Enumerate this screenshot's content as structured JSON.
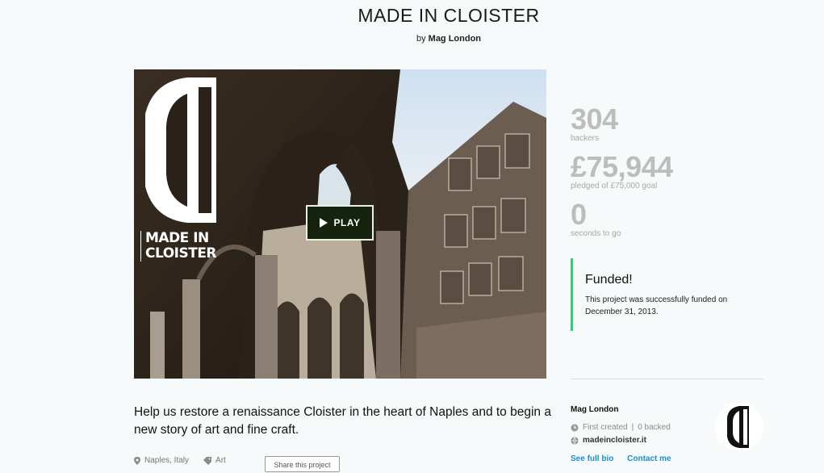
{
  "project": {
    "title": "MADE IN CLOISTER",
    "by_prefix": "by",
    "creator": "Mag London"
  },
  "video": {
    "play_label": "PLAY",
    "logo_text_line1": "MADE IN",
    "logo_text_line2": "CLOISTER"
  },
  "stats": {
    "backers_count": "304",
    "backers_label": "backers",
    "pledged_amount": "£75,944",
    "pledged_label": "pledged of £75,000 goal",
    "seconds": "0",
    "seconds_label": "seconds to go"
  },
  "funded": {
    "heading": "Funded!",
    "text": "This project was successfully funded on December 31, 2013."
  },
  "creator_card": {
    "name": "Mag London",
    "first_created": "First created",
    "separator": "|",
    "backed": "0 backed",
    "website": "madeincloister.it",
    "see_bio": "See full bio",
    "contact": "Contact me"
  },
  "blurb": "Help us restore a renaissance Cloister in the heart of Naples and to begin a new story of art and fine craft.",
  "footer": {
    "location": "Naples, Italy",
    "category": "Art",
    "share": "Share this project"
  },
  "colors": {
    "funded_accent": "#2bd26f",
    "link": "#1a8fd0",
    "stat_gray": "#bdbdbd"
  }
}
